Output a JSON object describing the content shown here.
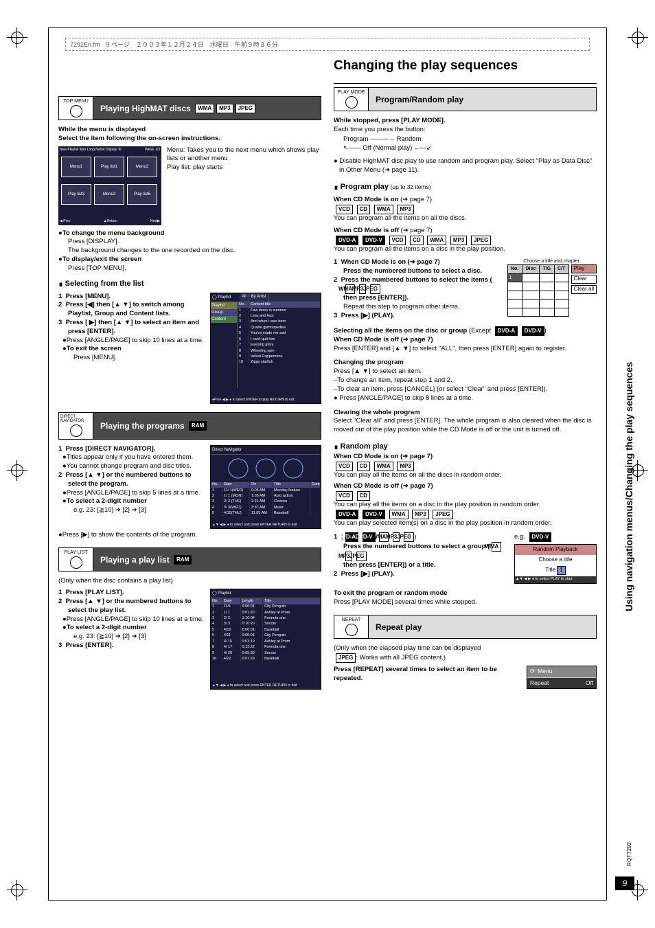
{
  "header_strip": "7292En.fm　9 ページ　２００３年１２月２４日　水曜日　午前９時３６分",
  "page_number": "9",
  "rqt_code": "RQT7292",
  "side_tab": "Using navigation menus/Changing the play sequences",
  "main_heading": "Changing the play sequences",
  "left": {
    "ribbon1_icon": "TOP MENU",
    "ribbon1_title": "Playing HighMAT discs",
    "ribbon1_fmts": [
      "WMA",
      "MP3",
      "JPEG"
    ],
    "l1": "While the menu is displayed",
    "l2": "Select the item following the on-screen instructions.",
    "menu_desc1": "Menu:",
    "menu_desc1b": "Takes you to the next menu which shows play lists or another menu",
    "menu_desc2": "Play list:",
    "menu_desc2b": "play starts",
    "menugrid": {
      "title": "New Playlist Item Long Name Display Te",
      "page": "PAGE 1/3",
      "cells": [
        "Menu1",
        "Play list1",
        "Menu2",
        "Play list3",
        "Menu3",
        "Play list5"
      ],
      "footer": [
        "◀ Prev",
        "▲Return",
        "Next▶"
      ]
    },
    "l3": "To change the menu background",
    "l3b": "Press [DISPLAY].",
    "l3c": "The background changes to the one recorded on the disc.",
    "l4": "To display/exit the screen",
    "l4b": "Press [TOP MENU].",
    "h_sel": "Selecting from the list",
    "s1": "Press [MENU].",
    "s2": "Press [◀] then [▲ ▼] to switch among Playlist, Group and Content lists.",
    "s3": "Press [ ▶] then [▲ ▼] to select an item and press [ENTER].",
    "s3a": "Press [ANGLE/PAGE] to skip 10 lines at a time.",
    "s3b": "To exit the screen",
    "s3c": "Press [MENU].",
    "playlist_sc": {
      "tabs": [
        "All",
        "By Artist"
      ],
      "side": [
        "Playlist",
        "Group",
        "Content"
      ],
      "header": [
        "No.",
        "Content title"
      ],
      "rows": [
        [
          "1",
          "Few times in summer"
        ],
        [
          "2",
          "Less and less"
        ],
        [
          "3",
          "And when I was born"
        ],
        [
          "4",
          "Quatre gymnopedies"
        ],
        [
          "5",
          "You've made me sad"
        ],
        [
          "6",
          "I can't quit him"
        ],
        [
          "7",
          "Evening glory"
        ],
        [
          "8",
          "Wheeling spin"
        ],
        [
          "9",
          "Velvet Cuppermine"
        ],
        [
          "10",
          "Ziggy starfish"
        ]
      ],
      "footer": "●Prev ◀ ▶ ●  to select  ENTER  to play        RETURN  to exit"
    },
    "ribbon2_icon": "DIRECT NAVIGATOR",
    "ribbon2_title": "Playing the programs",
    "ribbon2_fmts": [
      "RAM"
    ],
    "dn1": "Press [DIRECT NAVIGATOR].",
    "dn1a": "Titles appear only if you have entered them.",
    "dn1b": "You cannot change program and disc titles.",
    "dn2": "Press [▲ ▼] or the numbered buttons to select the program.",
    "dn2a": "Press [ANGLE/PAGE] to skip 5 lines at a time.",
    "dn2b": "To select a 2-digit number",
    "dn2c": "e.g. 23: [≧10] ➜ [2] ➜ [3]",
    "dn3": "Press [▶] to show the contents of the program.",
    "dn_sc": {
      "title": "Direct Navigator",
      "cols": [
        "No.",
        "Date",
        "On",
        "Title",
        "Contents"
      ],
      "rows": [
        [
          "1",
          "11/ 1(WED)",
          "0:05 AM",
          "Monday feature",
          ""
        ],
        [
          "2",
          "1/ 1 (MON)",
          "1:05 AM",
          "Auto action",
          ""
        ],
        [
          "3",
          "2/ 2 (TUE)",
          "2:21 AM",
          "Cinema",
          ""
        ],
        [
          "4",
          "3/ 3(WED)",
          "3:37 AM",
          "Music",
          ""
        ],
        [
          "5",
          "4/10(THU)",
          "11:05 AM",
          "Baseball",
          ""
        ]
      ],
      "footer": "▲▼ ◀ ▶ ● to select and press ENTER        RETURN to exit"
    },
    "ribbon3_icon": "PLAY LIST",
    "ribbon3_title": "Playing a play list",
    "ribbon3_fmts": [
      "RAM"
    ],
    "pl0": "(Only when the disc contains a play list)",
    "pl1": "Press [PLAY LIST].",
    "pl2": "Press [▲ ▼] or the numbered buttons to select the play list.",
    "pl2a": "Press [ANGLE/PAGE] to skip 10 lines at a time.",
    "pl2b": "To select a 2-digit number",
    "pl2c": "e.g. 23: [≧10] ➜ [2] ➜ [3]",
    "pl3": "Press [ENTER].",
    "pl_sc": {
      "title": "Playlist",
      "cols": [
        "No.",
        "Date",
        "Length",
        "Title"
      ],
      "rows": [
        [
          "1",
          "11/1",
          "0:00:01",
          "City Penguin"
        ],
        [
          "2",
          "1/ 1",
          "0:01:20",
          "Ashley at Prom"
        ],
        [
          "3",
          "2/ 2",
          "1:10:04",
          "Formula one"
        ],
        [
          "4",
          "3/ 3",
          "0:10:20",
          "Soccer"
        ],
        [
          "5",
          "4/10",
          "0:00:01",
          "Baseball"
        ],
        [
          "6",
          "4/11",
          "0:00:01",
          "City Penguin"
        ],
        [
          "7",
          "4/ 15",
          "0:01:10",
          "Ashley at Prom"
        ],
        [
          "8",
          "4/ 17",
          "0:13:22",
          "Formula one"
        ],
        [
          "9",
          "4/ 20",
          "0:05:30",
          "Soccer"
        ],
        [
          "10",
          "4/22",
          "0:07:29",
          "Baseball"
        ]
      ],
      "footer": "▲▼ ◀ ▶ ● to select and press ENTER        RETURN to exit"
    }
  },
  "right": {
    "ribbon1_icon": "PLAY MODE",
    "ribbon1_title": "Program/Random play",
    "r1": "While stopped, press [PLAY MODE].",
    "r1a": "Each time you press the button:",
    "cycle": {
      "a": "Program",
      "b": "Random",
      "c": "Off (Normal play)"
    },
    "r2": "Disable HighMAT disc play to use random and program play. Select \"Play as Data Disc\" in Other Menu (➜ page 11).",
    "h_prog": "Program play",
    "h_prog_sub": "(up to 32 items)",
    "cm_on": "When CD Mode is on",
    "cm_on_ref": "(➜ page 7)",
    "cm_on_fmts": [
      "VCD",
      "CD",
      "WMA",
      "MP3"
    ],
    "cm_on_txt": "You can program all the items on all the discs.",
    "cm_off": "When CD Mode is off",
    "cm_off_ref": "(➜ page 7)",
    "cm_off_fmts": [
      "DVD-A",
      "DVD-V",
      "VCD",
      "CD",
      "WMA",
      "MP3",
      "JPEG"
    ],
    "cm_off_txt": "You can program all the items on a disc in the play position.",
    "p1": "When CD Mode is on (➜ page 7)",
    "p1b": "Press the numbered buttons to select a disc.",
    "p2": "Press the numbered buttons to select the items (",
    "p2_fmts": [
      "WMA",
      "MP3",
      "JPEG"
    ],
    "p2b": "then press [ENTER]).",
    "p2c": "Repeat this step to program other items.",
    "p3": "Press [▶] (PLAY).",
    "chapter_title": "Choose a title and chapter.",
    "chapter_cols": [
      "No.",
      "Disc",
      "T/G",
      "C/T"
    ],
    "chapter_row1": "1",
    "chapter_btns": [
      "Play",
      "Clear",
      "Clear all"
    ],
    "sel_all": "Selecting all the items on the disc or group",
    "sel_all_exc": "(Except",
    "sel_all_fmts": [
      "DVD-A",
      "DVD-V"
    ],
    "sel_all_off": "When CD Mode is off (➜ page 7)",
    "sel_all_txt": "Press [ENTER] and [▲ ▼] to select \"ALL\", then press [ENTER] again to register.",
    "chg_h": "Changing the program",
    "chg1": "Press [▲ ▼] to select an item.",
    "chg2": "–To change an item, repeat step 1 and 2.",
    "chg3": "–To clear an item, press [CANCEL] (or select \"Clear\" and press [ENTER]).",
    "chg4": "Press [ANGLE/PAGE] to skip 8 lines at a time.",
    "clr_h": "Clearing the whole program",
    "clr_txt": "Select \"Clear all\" and press [ENTER]. The whole program is also cleared when the disc is moved out of the play position while the CD Mode is off or the unit is turned off.",
    "rnd_h": "Random play",
    "rnd_on": "When CD Mode is on (➜ page 7)",
    "rnd_on_fmts": [
      "VCD",
      "CD",
      "WMA",
      "MP3"
    ],
    "rnd_on_txt": "You can play all the items on all the discs in random order.",
    "rnd_off": "When CD Mode is off (➜ page 7)",
    "rnd_off_fmts1": [
      "VCD",
      "CD"
    ],
    "rnd_off_txt1": "You can play all the items on a disc in the play position in random order.",
    "rnd_off_fmts2": [
      "DVD-A",
      "DVD-V",
      "WMA",
      "MP3",
      "JPEG"
    ],
    "rnd_off_txt2": "You can play selected item(s) on a disc in the play position in random order.",
    "rp1_pre": "(",
    "rp1_fmts": [
      "DVD-A",
      "DVD-V",
      "WMA",
      "MP3",
      "JPEG"
    ],
    "rp1_post": ")",
    "rp1": "Press the numbered buttons to select a group (",
    "rp1b_fmts": [
      "WMA",
      "MP3",
      "JPEG"
    ],
    "rp1b": "then press [ENTER]) or a title.",
    "rp2": "Press [▶] (PLAY).",
    "eg": "e.g.",
    "eg_fmt": "DVD-V",
    "rand_panel": {
      "title": "Random Playback",
      "sub": "Choose a title",
      "row": "Title",
      "num": "1",
      "footer": "▲▼ ◀ ▶ ● to select    PLAY to start"
    },
    "exit_h": "To exit the program or random mode",
    "exit_txt": "Press [PLAY MODE] several times while stopped.",
    "rep_icon": "REPEAT",
    "rep_title": "Repeat play",
    "rep1": "(Only when the elapsed play time can be displayed",
    "rep2_fmt": "JPEG",
    "rep2": ": Works with all JPEG content.)",
    "rep3": "Press [REPEAT] several times to select an item to be repeated.",
    "menu_panel": {
      "hdr": "Menu",
      "label": "Repeat",
      "val": "Off"
    }
  }
}
